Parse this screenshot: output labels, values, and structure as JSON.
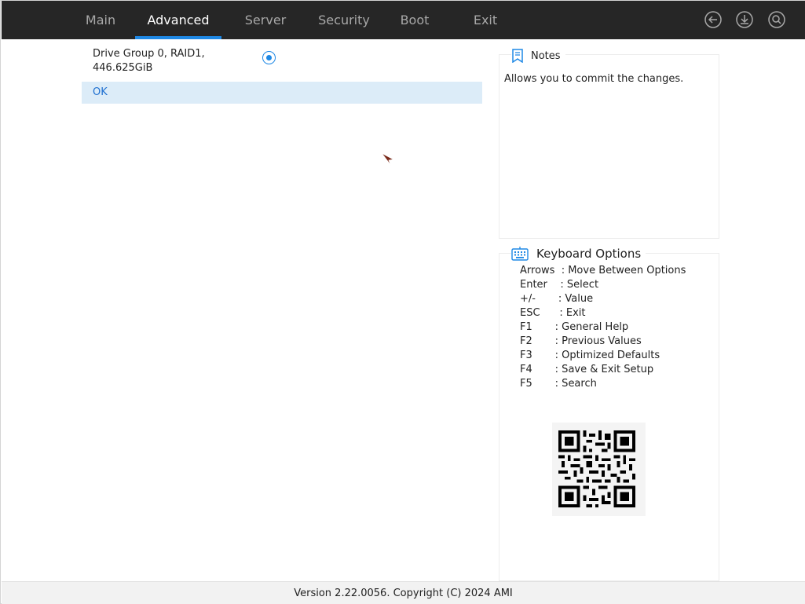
{
  "tabs": [
    {
      "label": "Main",
      "active": false
    },
    {
      "label": "Advanced",
      "active": true
    },
    {
      "label": "Server",
      "active": false
    },
    {
      "label": "Security",
      "active": false
    },
    {
      "label": "Boot",
      "active": false
    },
    {
      "label": "Exit",
      "active": false
    }
  ],
  "toolbar_icons": [
    "back-icon",
    "save-download-icon",
    "search-icon"
  ],
  "main": {
    "option": {
      "label_line1": "Drive Group 0, RAID1,",
      "label_line2": "446.625GiB",
      "selected": true
    },
    "ok_label": "OK"
  },
  "notes": {
    "title": "Notes",
    "text": "Allows you to commit the changes."
  },
  "keyboard": {
    "title": "Keyboard Options",
    "lines": [
      "Arrows  : Move Between Options",
      "Enter    : Select",
      "+/-       : Value",
      "ESC      : Exit",
      "F1       : General Help",
      "F2       : Previous Values",
      "F3       : Optimized Defaults",
      "F4       : Save & Exit Setup",
      "F5       : Search"
    ]
  },
  "footer": "Version 2.22.0056. Copyright (C) 2024 AMI",
  "colors": {
    "topbar": "#262626",
    "accent": "#1e88e5",
    "selected_row": "#dcecf8",
    "tab_inactive": "#a8a8a8"
  }
}
